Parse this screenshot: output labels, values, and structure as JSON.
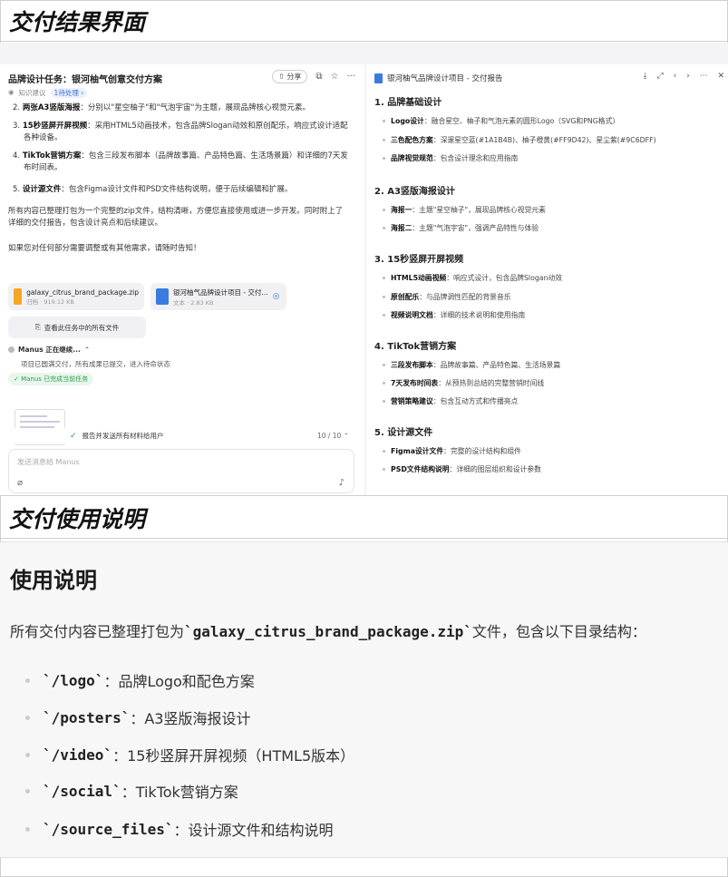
{
  "sections": {
    "delivery_result": "交付结果界面",
    "usage_guide": "交付使用说明"
  },
  "left_pane": {
    "title": "品牌设计任务：银河柚气创意交付方案",
    "share_label": "分享",
    "sub_label": "知识建议",
    "sub_tag": "1待处理 ›",
    "items": [
      {
        "num": "2.",
        "bold": "两张A3竖版海报",
        "text": "：分别以\"星空柚子\"和\"气泡宇宙\"为主题，展现品牌核心视觉元素。"
      },
      {
        "num": "3.",
        "bold": "15秒竖屏开屏视频",
        "text": "：采用HTML5动画技术，包含品牌Slogan动效和原创配乐，响应式设计适配",
        "cont": "各种设备。"
      },
      {
        "num": "4.",
        "bold": "TikTok营销方案",
        "text": "：包含三段发布脚本（品牌故事篇、产品特色篇、生活场景篇）和详细的7天发",
        "cont": "布时间表。"
      },
      {
        "num": "5.",
        "bold": "设计源文件",
        "text": "：包含Figma设计文件和PSD文件结构说明，便于后续编辑和扩展。"
      }
    ],
    "para1": "所有内容已整理打包为一个完整的zip文件，结构清晰，方便您直接使用或进一步开发。同时附上了",
    "para1b": "详细的交付报告，包含设计亮点和后续建议。",
    "para2": "如果您对任何部分需要调整或有其他需求，请随时告知！",
    "file1": {
      "name": "galaxy_citrus_brand_package.zip",
      "meta": "归档 · 919.12 KB"
    },
    "file2": {
      "name": "银河柚气品牌设计项目 - 交付...",
      "meta": "文本 · 2.83 KB"
    },
    "all_files": "查看此任务中的所有文件",
    "status": "Manus 正在继续...",
    "status_detail": "项目已圆满交付，所有成果已提交，进入待命状态",
    "done": "✓ Manus 已完成当前任务",
    "task_text": "报告并发送所有材料给用户",
    "task_count": "10 / 10",
    "input_placeholder": "发送消息给 Manus"
  },
  "right_pane": {
    "title": "银河柚气品牌设计项目 - 交付报告",
    "sections": [
      {
        "heading": "1. 品牌基础设计",
        "items": [
          {
            "bold": "Logo设计",
            "text": "：融合星空、柚子和气泡元素的圆形Logo（SVG和PNG格式）"
          },
          {
            "bold": "三色配色方案",
            "text": "：深邃星空蓝(#1A1B4B)、柚子橙黄(#FF9D42)、星尘紫(#9C6DFF)"
          },
          {
            "bold": "品牌视觉规范",
            "text": "：包含设计理念和应用指南"
          }
        ]
      },
      {
        "heading": "2. A3竖版海报设计",
        "items": [
          {
            "bold": "海报一",
            "text": "：主题\"星空柚子\"，展现品牌核心视觉元素"
          },
          {
            "bold": "海报二",
            "text": "：主题\"气泡宇宙\"，强调产品特性与体验"
          }
        ]
      },
      {
        "heading": "3. 15秒竖屏开屏视频",
        "items": [
          {
            "bold": "HTML5动画视频",
            "text": "：响应式设计，包含品牌Slogan动效"
          },
          {
            "bold": "原创配乐",
            "text": "：与品牌调性匹配的背景音乐"
          },
          {
            "bold": "视频说明文档",
            "text": "：详细的技术说明和使用指南"
          }
        ]
      },
      {
        "heading": "4. TikTok营销方案",
        "items": [
          {
            "bold": "三段发布脚本",
            "text": "：品牌故事篇、产品特色篇、生活场景篇"
          },
          {
            "bold": "7天发布时间表",
            "text": "：从预热到总结的完整营销时间线"
          },
          {
            "bold": "营销策略建议",
            "text": "：包含互动方式和传播亮点"
          }
        ]
      },
      {
        "heading": "5. 设计源文件",
        "items": [
          {
            "bold": "Figma设计文件",
            "text": "：完整的设计结构和组件"
          },
          {
            "bold": "PSD文件结构说明",
            "text": "：详细的图层组织和设计参数"
          }
        ]
      }
    ]
  },
  "doc": {
    "heading": "使用说明",
    "intro_pre": "所有交付内容已整理打包为",
    "intro_code": "`galaxy_citrus_brand_package.zip`",
    "intro_post": "文件，包含以下目录结构：",
    "items": [
      {
        "code": "`/logo`",
        "text": "：品牌Logo和配色方案"
      },
      {
        "code": "`/posters`",
        "text": "：A3竖版海报设计"
      },
      {
        "code": "`/video`",
        "text": "：15秒竖屏开屏视频（HTML5版本）"
      },
      {
        "code": "`/social`",
        "text": "：TikTok营销方案"
      },
      {
        "code": "`/source_files`",
        "text": "：设计源文件和结构说明"
      }
    ]
  }
}
